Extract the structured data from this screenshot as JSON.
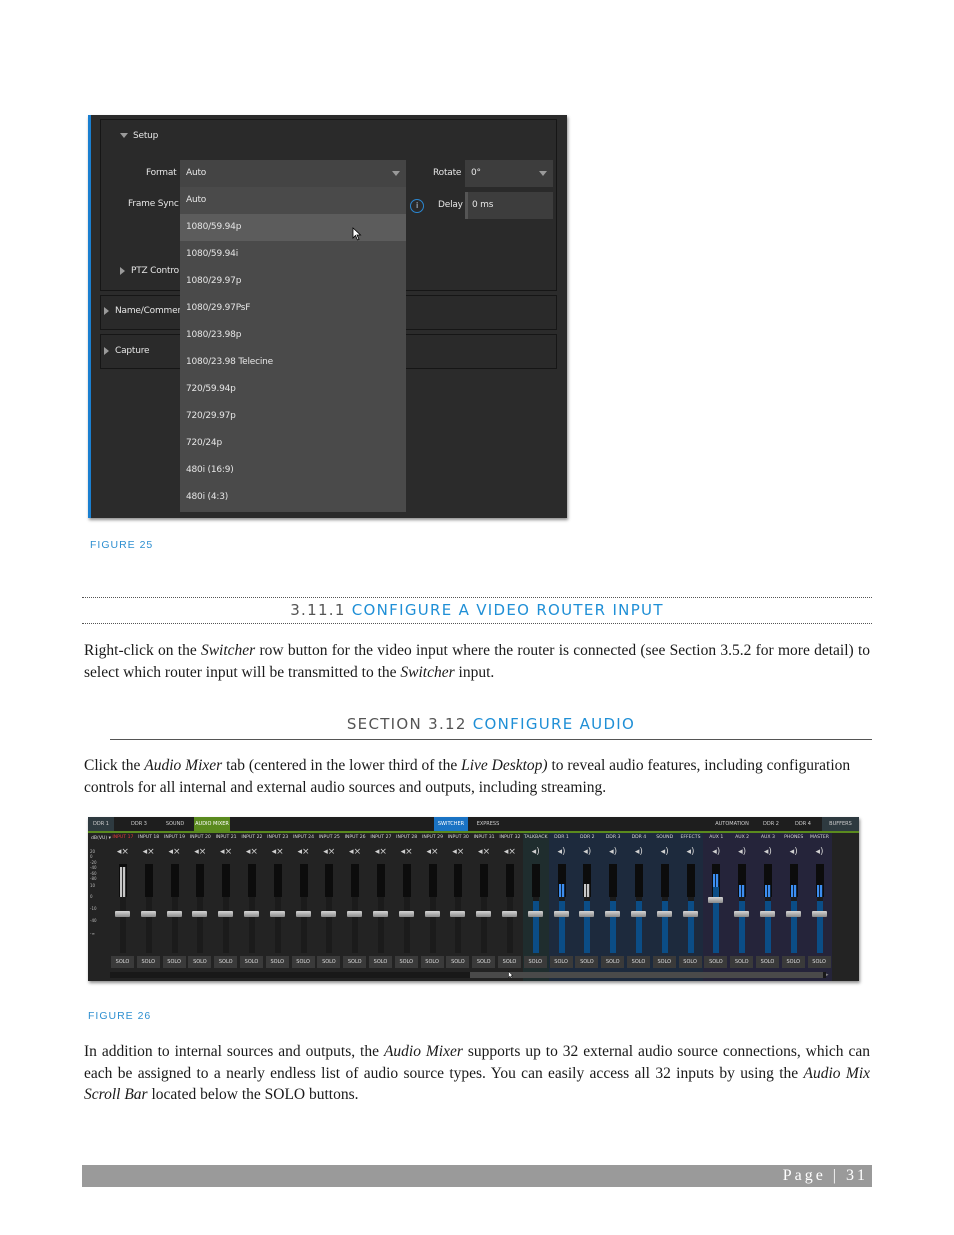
{
  "figure25": {
    "setup_label": "Setup",
    "format_label": "Format",
    "format_value": "Auto",
    "frame_sync_label": "Frame Sync",
    "rotate_label": "Rotate",
    "rotate_value": "0°",
    "delay_label": "Delay",
    "delay_value": "0 ms",
    "info_icon": "i",
    "ptz_label": "PTZ Contro",
    "name_comment_label": "Name/Commen",
    "capture_label": "Capture",
    "format_options": [
      "Auto",
      "1080/59.94p",
      "1080/59.94i",
      "1080/29.97p",
      "1080/29.97PsF",
      "1080/23.98p",
      "1080/23.98 Telecine",
      "720/59.94p",
      "720/29.97p",
      "720/24p",
      "480i (16:9)",
      "480i (4:3)"
    ],
    "highlighted_option": "1080/59.94p",
    "caption": "FIGURE 25"
  },
  "section_3_11_1": {
    "number": "3.11.1",
    "title": "CONFIGURE A VIDEO ROUTER INPUT",
    "para_1a": "Right-click on the ",
    "para_1b": "Switcher",
    "para_1c": " row button for the video input where the router is connected (see Section 3.5.2 for more detail) to select which router input will be transmitted to the ",
    "para_1d": "Switcher",
    "para_1e": " input."
  },
  "section_3_12": {
    "number": "SECTION 3.12",
    "title": "CONFIGURE AUDIO",
    "para_1a": "Click the ",
    "para_1b": "Audio Mixer",
    "para_1c": " tab (centered in the lower third of the ",
    "para_1d": "Live Desktop)",
    "para_1e": " to reveal audio features, including configuration controls for all internal and external audio sources and outputs, including streaming."
  },
  "figure26": {
    "tabs_left": [
      "DDR 1",
      "DDR 3",
      "SOUND",
      "AUDIO MIXER"
    ],
    "tabs_center": [
      "SWITCHER",
      "EXPRESS"
    ],
    "tabs_right": [
      "AUTOMATION",
      "DDR 2",
      "DDR 4",
      "BUFFERS"
    ],
    "db_selector": "dB(VU)",
    "db_scale": [
      "20",
      "0",
      "-20",
      "-40",
      "-60",
      "-80",
      "10",
      "0",
      "-10",
      "-40",
      "-∞"
    ],
    "channels": [
      {
        "label": "INPUT 17",
        "muted": true,
        "group": "input",
        "meter": 0.9,
        "fader": 0.0,
        "meter_color": "gray",
        "label_color": "red"
      },
      {
        "label": "INPUT 18",
        "muted": true,
        "group": "input",
        "meter": 0,
        "fader": 0.0
      },
      {
        "label": "INPUT 19",
        "muted": true,
        "group": "input",
        "meter": 0,
        "fader": 0.0
      },
      {
        "label": "INPUT 20",
        "muted": true,
        "group": "input",
        "meter": 0,
        "fader": 0.0
      },
      {
        "label": "INPUT 21",
        "muted": true,
        "group": "input",
        "meter": 0,
        "fader": 0.0
      },
      {
        "label": "INPUT 22",
        "muted": true,
        "group": "input",
        "meter": 0,
        "fader": 0.0
      },
      {
        "label": "INPUT 23",
        "muted": true,
        "group": "input",
        "meter": 0,
        "fader": 0.0
      },
      {
        "label": "INPUT 24",
        "muted": true,
        "group": "input",
        "meter": 0,
        "fader": 0.0
      },
      {
        "label": "INPUT 25",
        "muted": true,
        "group": "input",
        "meter": 0,
        "fader": 0.0
      },
      {
        "label": "INPUT 26",
        "muted": true,
        "group": "input",
        "meter": 0,
        "fader": 0.0
      },
      {
        "label": "INPUT 27",
        "muted": true,
        "group": "input",
        "meter": 0,
        "fader": 0.0
      },
      {
        "label": "INPUT 28",
        "muted": true,
        "group": "input",
        "meter": 0,
        "fader": 0.0
      },
      {
        "label": "INPUT 29",
        "muted": true,
        "group": "input",
        "meter": 0,
        "fader": 0.0
      },
      {
        "label": "INPUT 30",
        "muted": true,
        "group": "input",
        "meter": 0,
        "fader": 0.0
      },
      {
        "label": "INPUT 31",
        "muted": true,
        "group": "input",
        "meter": 0,
        "fader": 0.0
      },
      {
        "label": "INPUT 32",
        "muted": true,
        "group": "input",
        "meter": 0,
        "fader": 0.0
      },
      {
        "label": "TALKBACK",
        "muted": false,
        "group": "talkback",
        "meter": 0,
        "fader": 0.0
      },
      {
        "label": "DDR 1",
        "muted": false,
        "group": "internal",
        "meter": 0.4,
        "fader": 0.0,
        "meter_color": "blue"
      },
      {
        "label": "DDR 2",
        "muted": false,
        "group": "internal",
        "meter": 0.4,
        "fader": 0.0,
        "meter_color": "gray"
      },
      {
        "label": "DDR 3",
        "muted": false,
        "group": "internal",
        "meter": 0,
        "fader": 0.0
      },
      {
        "label": "DDR 4",
        "muted": false,
        "group": "internal",
        "meter": 0,
        "fader": 0.0
      },
      {
        "label": "SOUND",
        "muted": false,
        "group": "internal",
        "meter": 0,
        "fader": 0.0
      },
      {
        "label": "EFFECTS",
        "muted": false,
        "group": "internal",
        "meter": 0,
        "fader": 0.0
      },
      {
        "label": "AUX 1",
        "muted": false,
        "group": "output",
        "meter": 0.7,
        "fader": 0.25,
        "meter_color": "blue"
      },
      {
        "label": "AUX 2",
        "muted": false,
        "group": "output",
        "meter": 0.35,
        "fader": 0.0,
        "meter_color": "blue"
      },
      {
        "label": "AUX 3",
        "muted": false,
        "group": "output",
        "meter": 0.35,
        "fader": 0.0,
        "meter_color": "blue"
      },
      {
        "label": "PHONES",
        "muted": false,
        "group": "output",
        "meter": 0.35,
        "fader": 0.0,
        "meter_color": "blue"
      },
      {
        "label": "MASTER",
        "muted": false,
        "group": "output",
        "meter": 0.35,
        "fader": 0.0,
        "meter_color": "blue"
      }
    ],
    "solo_label": "SOLO",
    "caption": "FIGURE 26"
  },
  "paragraph_after": {
    "a": "In addition to internal sources and outputs, the ",
    "b": "Audio Mixer",
    "c": " supports up to 32 external audio source connections, which can each be assigned to a nearly endless list of audio source types. You can easily access all 32 inputs by using the ",
    "d": "Audio Mix Scroll Bar",
    "e": " located below the SOLO buttons."
  },
  "footer": {
    "page_label": "Page | 31"
  },
  "colors": {
    "accent_blue": "#1f8fd6",
    "audio_mixer_tab": "#5a8a1e",
    "switcher_tab": "#1a73c4",
    "footer_bar": "#9a9a9a"
  }
}
